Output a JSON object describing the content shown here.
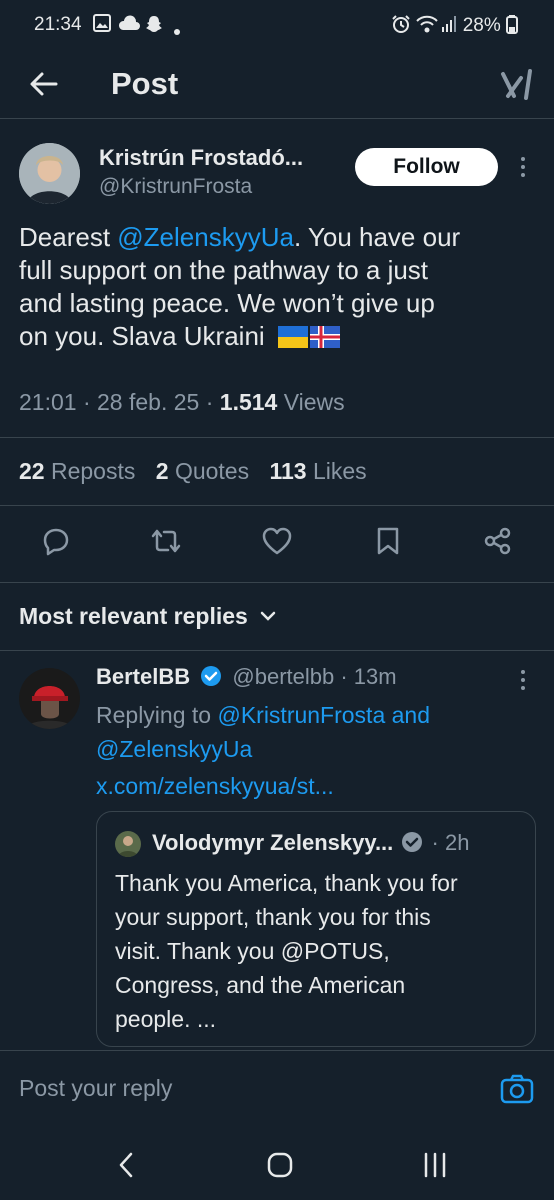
{
  "status_bar": {
    "time": "21:34",
    "battery": "28%"
  },
  "header": {
    "title": "Post"
  },
  "post": {
    "author_name": "Kristrún Frostadó...",
    "author_handle": "@KristrunFrosta",
    "follow_label": "Follow",
    "text_before_mention": "Dearest ",
    "mention": "@ZelenskyyUa",
    "text_line1_rest": ". You have our",
    "text_line2": "full support on the pathway to a just",
    "text_line3": "and lasting peace. We won’t give up",
    "text_line4": "on you. Slava Ukraini",
    "time": "21:01",
    "date": "28 feb. 25",
    "views_count": "1.514",
    "views_label": "Views",
    "reposts_count": "22",
    "reposts_label": "Reposts",
    "quotes_count": "2",
    "quotes_label": "Quotes",
    "likes_count": "113",
    "likes_label": "Likes"
  },
  "replies_section": {
    "heading": "Most relevant replies"
  },
  "reply": {
    "author_name": "BertelBB",
    "author_handle": "@bertelbb",
    "age": "13m",
    "replying_to_label": "Replying to",
    "replying_to_user1": "@KristrunFrosta",
    "replying_to_and": "and",
    "replying_to_user2": "@ZelenskyyUa",
    "link": "x.com/zelenskyyua/st...",
    "quote": {
      "author_name": "Volodymyr Zelenskyy...",
      "age": "2h",
      "line1": "Thank you America, thank you for",
      "line2": "your support, thank you for this",
      "line3": "visit. Thank you @POTUS,",
      "line4": "Congress, and the American",
      "line5": "people. ..."
    }
  },
  "compose": {
    "placeholder": "Post your reply"
  },
  "colors": {
    "background": "#15202b",
    "accent": "#1d9bf0",
    "muted": "#8b98a5",
    "divider": "#38444d"
  }
}
